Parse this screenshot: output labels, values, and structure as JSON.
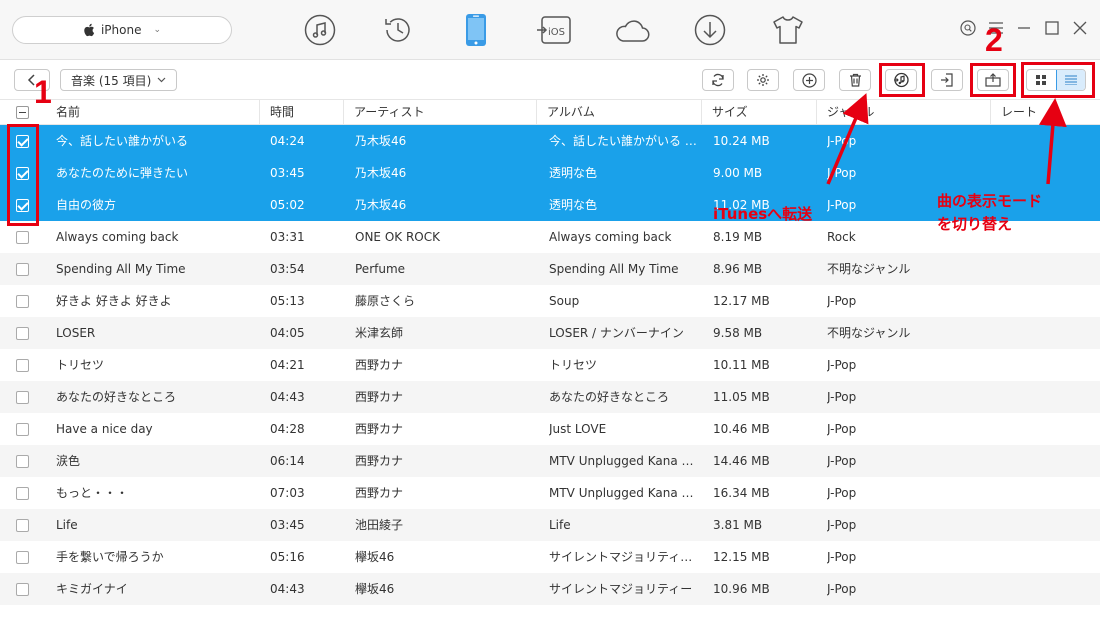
{
  "topbar": {
    "device_name": "iPhone",
    "nav_icons": [
      "music-icon",
      "history-icon",
      "phone-icon",
      "ios-icon",
      "cloud-icon",
      "download-icon",
      "tshirt-icon"
    ],
    "ios_label": "iOS"
  },
  "toolbar": {
    "category_label": "音楽 (15 項目)"
  },
  "table": {
    "headers": [
      "名前",
      "時間",
      "アーティスト",
      "アルバム",
      "サイズ",
      "ジャンル",
      "レート"
    ],
    "rows": [
      {
        "name": "今、話したい誰かがいる",
        "time": "04:24",
        "artist": "乃木坂46",
        "album": "今、話したい誰かがいる (Sp...",
        "size": "10.24 MB",
        "genre": "J-Pop",
        "selected": true
      },
      {
        "name": "あなたのために弾きたい",
        "time": "03:45",
        "artist": "乃木坂46",
        "album": "透明な色",
        "size": "9.00 MB",
        "genre": "J-Pop",
        "selected": true
      },
      {
        "name": "自由の彼方",
        "time": "05:02",
        "artist": "乃木坂46",
        "album": "透明な色",
        "size": "11.02 MB",
        "genre": "J-Pop",
        "selected": true
      },
      {
        "name": "Always coming back",
        "time": "03:31",
        "artist": "ONE OK ROCK",
        "album": "Always coming back",
        "size": "8.19 MB",
        "genre": "Rock",
        "selected": false
      },
      {
        "name": "Spending All My Time",
        "time": "03:54",
        "artist": "Perfume",
        "album": "Spending All My Time",
        "size": "8.96 MB",
        "genre": "不明なジャンル",
        "selected": false
      },
      {
        "name": "好きよ 好きよ 好きよ",
        "time": "05:13",
        "artist": "藤原さくら",
        "album": "Soup",
        "size": "12.17 MB",
        "genre": "J-Pop",
        "selected": false
      },
      {
        "name": "LOSER",
        "time": "04:05",
        "artist": "米津玄師",
        "album": "LOSER / ナンバーナイン",
        "size": "9.58 MB",
        "genre": "不明なジャンル",
        "selected": false
      },
      {
        "name": "トリセツ",
        "time": "04:21",
        "artist": "西野カナ",
        "album": "トリセツ",
        "size": "10.11 MB",
        "genre": "J-Pop",
        "selected": false
      },
      {
        "name": "あなたの好きなところ",
        "time": "04:43",
        "artist": "西野カナ",
        "album": "あなたの好きなところ",
        "size": "11.05 MB",
        "genre": "J-Pop",
        "selected": false
      },
      {
        "name": "Have a nice day",
        "time": "04:28",
        "artist": "西野カナ",
        "album": "Just LOVE",
        "size": "10.46 MB",
        "genre": "J-Pop",
        "selected": false
      },
      {
        "name": "涙色",
        "time": "06:14",
        "artist": "西野カナ",
        "album": "MTV Unplugged Kana Ni...",
        "size": "14.46 MB",
        "genre": "J-Pop",
        "selected": false
      },
      {
        "name": "もっと・・・",
        "time": "07:03",
        "artist": "西野カナ",
        "album": "MTV Unplugged Kana Ni...",
        "size": "16.34 MB",
        "genre": "J-Pop",
        "selected": false
      },
      {
        "name": "Life",
        "time": "03:45",
        "artist": "池田綾子",
        "album": "Life",
        "size": "3.81 MB",
        "genre": "J-Pop",
        "selected": false
      },
      {
        "name": "手を繋いで帰ろうか",
        "time": "05:16",
        "artist": "欅坂46",
        "album": "サイレントマジョリティー (Spec...",
        "size": "12.15 MB",
        "genre": "J-Pop",
        "selected": false
      },
      {
        "name": "キミガイナイ",
        "time": "04:43",
        "artist": "欅坂46",
        "album": "サイレントマジョリティー",
        "size": "10.96 MB",
        "genre": "J-Pop",
        "selected": false
      }
    ]
  },
  "annotations": {
    "step1": "1",
    "step2": "2",
    "itunes_label": "iTunesへ転送",
    "mode_label_line1": "曲の表示モード",
    "mode_label_line2": "を切り替え",
    "color": "#e60012"
  },
  "colors": {
    "selected_row": "#1aa1ea",
    "accent": "#3a9be6"
  }
}
